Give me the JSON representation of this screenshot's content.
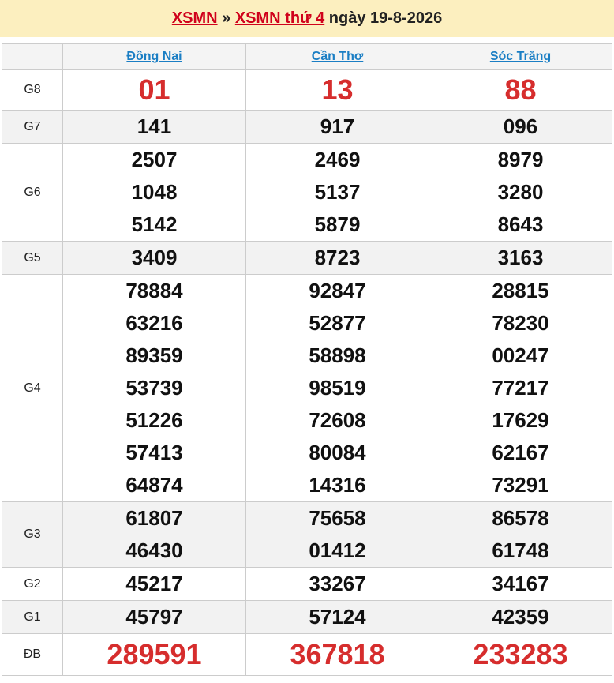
{
  "header": {
    "link1": "XSMN",
    "sep": " » ",
    "link2": "XSMN thứ 4",
    "date": " ngày 19-8-2026"
  },
  "provinces": [
    "Đồng Nai",
    "Cần Thơ",
    "Sóc Trăng"
  ],
  "colors": {
    "accent_red": "#d62d2d",
    "header_bg": "#fcefbf",
    "link_blue": "#1a7ec4"
  },
  "prizes": [
    {
      "label": "G8",
      "values": [
        [
          "01"
        ],
        [
          "13"
        ],
        [
          "88"
        ]
      ]
    },
    {
      "label": "G7",
      "values": [
        [
          "141"
        ],
        [
          "917"
        ],
        [
          "096"
        ]
      ]
    },
    {
      "label": "G6",
      "values": [
        [
          "2507",
          "1048",
          "5142"
        ],
        [
          "2469",
          "5137",
          "5879"
        ],
        [
          "8979",
          "3280",
          "8643"
        ]
      ]
    },
    {
      "label": "G5",
      "values": [
        [
          "3409"
        ],
        [
          "8723"
        ],
        [
          "3163"
        ]
      ]
    },
    {
      "label": "G4",
      "values": [
        [
          "78884",
          "63216",
          "89359",
          "53739",
          "51226",
          "57413",
          "64874"
        ],
        [
          "92847",
          "52877",
          "58898",
          "98519",
          "72608",
          "80084",
          "14316"
        ],
        [
          "28815",
          "78230",
          "00247",
          "77217",
          "17629",
          "62167",
          "73291"
        ]
      ]
    },
    {
      "label": "G3",
      "values": [
        [
          "61807",
          "46430"
        ],
        [
          "75658",
          "01412"
        ],
        [
          "86578",
          "61748"
        ]
      ]
    },
    {
      "label": "G2",
      "values": [
        [
          "45217"
        ],
        [
          "33267"
        ],
        [
          "34167"
        ]
      ]
    },
    {
      "label": "G1",
      "values": [
        [
          "45797"
        ],
        [
          "57124"
        ],
        [
          "42359"
        ]
      ]
    },
    {
      "label": "ĐB",
      "values": [
        [
          "289591"
        ],
        [
          "367818"
        ],
        [
          "233283"
        ]
      ]
    }
  ]
}
